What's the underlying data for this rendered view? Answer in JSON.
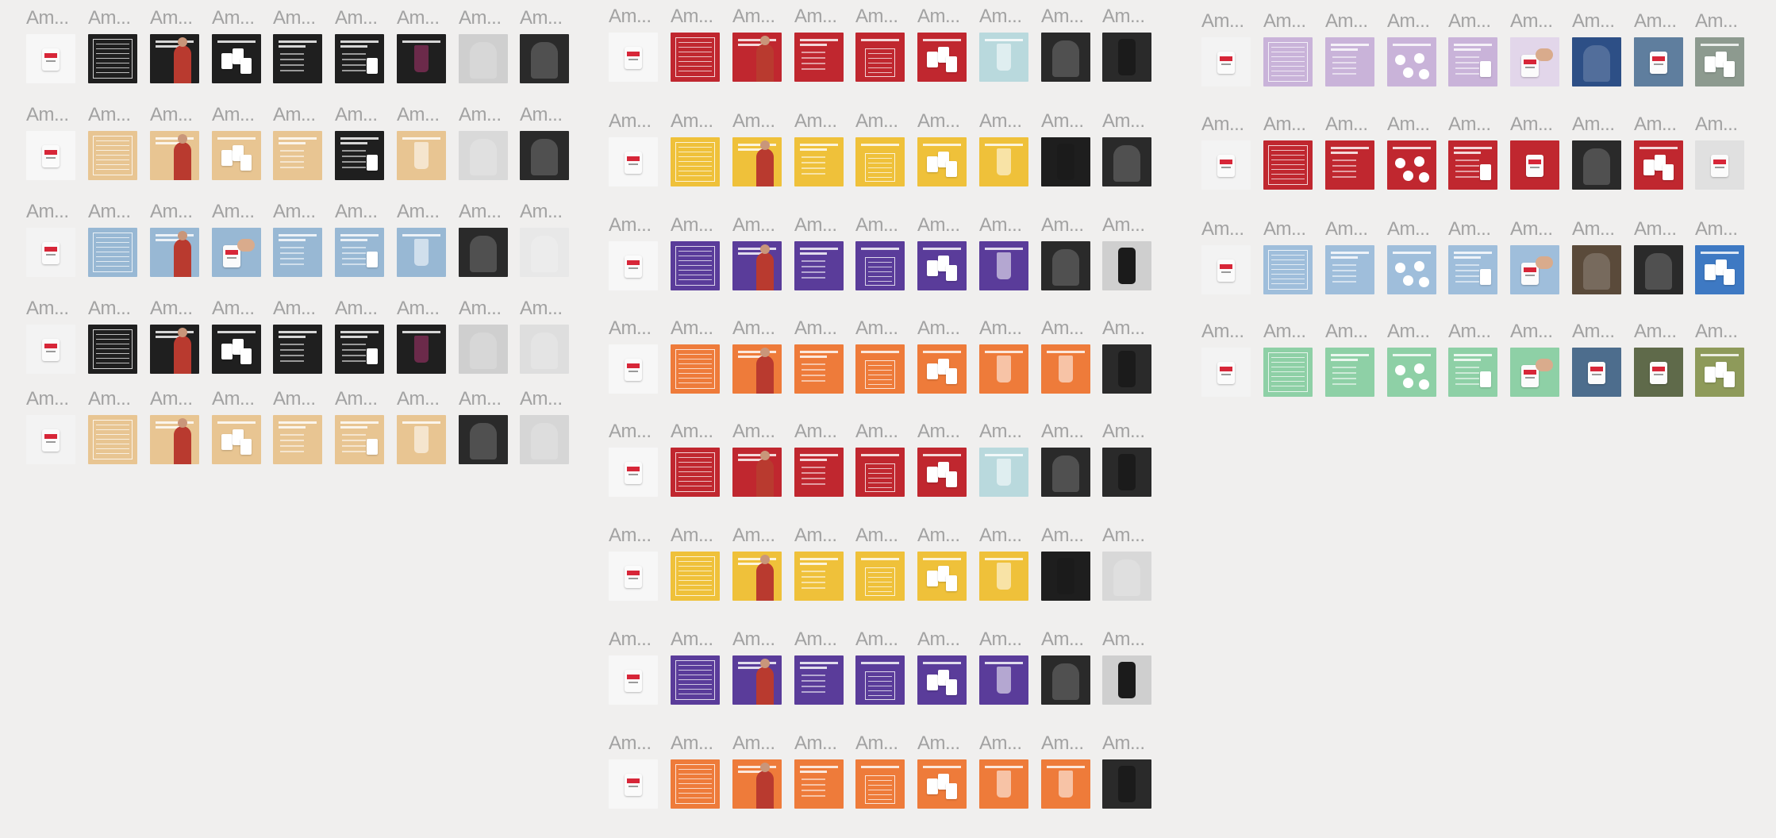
{
  "frame_label": "Am...",
  "colors": {
    "background": "#f0efee",
    "label": "#a2a2a2",
    "accent_red": "#d72638"
  },
  "groups": [
    {
      "name": "protein-set",
      "rows": [
        {
          "bg": [
            "#f7f7f7",
            "#1f1f1f",
            "#1f1f1f",
            "#1f1f1f",
            "#1f1f1f",
            "#1f1f1f",
            "#1f1f1f",
            "#cfcfcf",
            "#2a2a2a"
          ],
          "kind": [
            "product",
            "nutrition",
            "person",
            "packs",
            "text",
            "howto",
            "drink",
            "photo",
            "photo"
          ]
        },
        {
          "bg": [
            "#f7f7f7",
            "#e8c592",
            "#e8c592",
            "#e8c592",
            "#e8c592",
            "#1f1f1f",
            "#e8c592",
            "#d9d9d9",
            "#2a2a2a"
          ],
          "kind": [
            "product",
            "nutrition",
            "person",
            "packs",
            "text",
            "howto",
            "drink",
            "photo",
            "photo"
          ]
        },
        {
          "bg": [
            "#f3f3f3",
            "#98b8d4",
            "#98b8d4",
            "#98b8d4",
            "#98b8d4",
            "#98b8d4",
            "#98b8d4",
            "#2a2a2a",
            "#e8e8e8"
          ],
          "kind": [
            "product",
            "nutrition",
            "person",
            "hand",
            "text",
            "howto",
            "drink",
            "photo",
            "photo"
          ]
        },
        {
          "bg": [
            "#f3f3f3",
            "#1f1f1f",
            "#1f1f1f",
            "#1f1f1f",
            "#1f1f1f",
            "#1f1f1f",
            "#1f1f1f",
            "#cfcfcf",
            "#dedede"
          ],
          "kind": [
            "product",
            "nutrition",
            "person",
            "packs",
            "text",
            "howto",
            "drink",
            "photo",
            "photo"
          ]
        },
        {
          "bg": [
            "#f3f3f3",
            "#e8c592",
            "#e8c592",
            "#e8c592",
            "#e8c592",
            "#e8c592",
            "#e8c592",
            "#2a2a2a",
            "#d6d6d6"
          ],
          "kind": [
            "product",
            "nutrition",
            "person",
            "packs",
            "text",
            "howto",
            "drink",
            "photo",
            "photo"
          ]
        }
      ]
    },
    {
      "name": "hydration-set",
      "rows": [
        {
          "bg": [
            "#f7f7f7",
            "#c0272f",
            "#c0272f",
            "#c0272f",
            "#c0272f",
            "#c0272f",
            "#b9d9dd",
            "#2a2a2a",
            "#2a2a2a"
          ],
          "kind": [
            "product",
            "nutrition",
            "person",
            "text",
            "table",
            "packs",
            "drink",
            "photo",
            "shaker"
          ]
        },
        {
          "bg": [
            "#f7f7f7",
            "#efc13a",
            "#efc13a",
            "#efc13a",
            "#efc13a",
            "#efc13a",
            "#efc13a",
            "#1e1e1e",
            "#2a2a2a"
          ],
          "kind": [
            "product",
            "nutrition",
            "person",
            "text",
            "table",
            "packs",
            "drink",
            "shaker",
            "photo"
          ]
        },
        {
          "bg": [
            "#f7f7f7",
            "#5a3c9a",
            "#5a3c9a",
            "#5a3c9a",
            "#5a3c9a",
            "#5a3c9a",
            "#5a3c9a",
            "#2a2a2a",
            "#cfcfcf"
          ],
          "kind": [
            "product",
            "nutrition",
            "person",
            "text",
            "table",
            "packs",
            "drink",
            "photo",
            "shaker"
          ]
        },
        {
          "bg": [
            "#f7f7f7",
            "#ee7b3a",
            "#ee7b3a",
            "#ee7b3a",
            "#ee7b3a",
            "#ee7b3a",
            "#ee7b3a",
            "#ee7b3a",
            "#2a2a2a"
          ],
          "kind": [
            "product",
            "nutrition",
            "person",
            "text",
            "table",
            "packs",
            "drink",
            "drink",
            "shaker"
          ]
        },
        {
          "bg": [
            "#f7f7f7",
            "#c0272f",
            "#c0272f",
            "#c0272f",
            "#c0272f",
            "#c0272f",
            "#b9d9dd",
            "#2a2a2a",
            "#2a2a2a"
          ],
          "kind": [
            "product",
            "nutrition",
            "person",
            "text",
            "table",
            "packs",
            "drink",
            "photo",
            "shaker"
          ]
        },
        {
          "bg": [
            "#f7f7f7",
            "#efc13a",
            "#efc13a",
            "#efc13a",
            "#efc13a",
            "#efc13a",
            "#efc13a",
            "#1e1e1e",
            "#d8d8d8"
          ],
          "kind": [
            "product",
            "nutrition",
            "person",
            "text",
            "table",
            "packs",
            "drink",
            "shaker",
            "photo"
          ]
        },
        {
          "bg": [
            "#f7f7f7",
            "#5a3c9a",
            "#5a3c9a",
            "#5a3c9a",
            "#5a3c9a",
            "#5a3c9a",
            "#5a3c9a",
            "#2a2a2a",
            "#cfcfcf"
          ],
          "kind": [
            "product",
            "nutrition",
            "person",
            "text",
            "table",
            "packs",
            "drink",
            "photo",
            "shaker"
          ]
        },
        {
          "bg": [
            "#f7f7f7",
            "#ee7b3a",
            "#ee7b3a",
            "#ee7b3a",
            "#ee7b3a",
            "#ee7b3a",
            "#ee7b3a",
            "#ee7b3a",
            "#2a2a2a"
          ],
          "kind": [
            "product",
            "nutrition",
            "person",
            "text",
            "table",
            "packs",
            "drink",
            "drink",
            "shaker"
          ]
        }
      ]
    },
    {
      "name": "supplement-set",
      "rows": [
        {
          "bg": [
            "#f3f3f3",
            "#c9b3d9",
            "#c9b3d9",
            "#c9b3d9",
            "#c9b3d9",
            "#e2d6ea",
            "#2d4f86",
            "#5f7e9e",
            "#8d9a8f"
          ],
          "kind": [
            "product",
            "nutrition",
            "text",
            "dots",
            "howto",
            "hand",
            "photo",
            "product",
            "packs"
          ]
        },
        {
          "bg": [
            "#f3f3f3",
            "#c0272f",
            "#c0272f",
            "#c0272f",
            "#c0272f",
            "#c0272f",
            "#2a2a2a",
            "#c0272f",
            "#e0e0e0"
          ],
          "kind": [
            "product",
            "nutrition",
            "text",
            "dots",
            "howto",
            "product",
            "photo",
            "packs",
            "product"
          ]
        },
        {
          "bg": [
            "#f3f3f3",
            "#9fbedb",
            "#9fbedb",
            "#9fbedb",
            "#9fbedb",
            "#9fbedb",
            "#5a4a3a",
            "#2a2a2a",
            "#3e79c3"
          ],
          "kind": [
            "product",
            "nutrition",
            "text",
            "dots",
            "howto",
            "hand",
            "photo",
            "photo",
            "packs"
          ]
        },
        {
          "bg": [
            "#f3f3f3",
            "#8ed0a6",
            "#8ed0a6",
            "#8ed0a6",
            "#8ed0a6",
            "#8ed0a6",
            "#4d6d8d",
            "#5f6a4a",
            "#8e9a5a"
          ],
          "kind": [
            "product",
            "nutrition",
            "text",
            "dots",
            "howto",
            "hand",
            "product",
            "product",
            "packs"
          ]
        }
      ]
    }
  ]
}
